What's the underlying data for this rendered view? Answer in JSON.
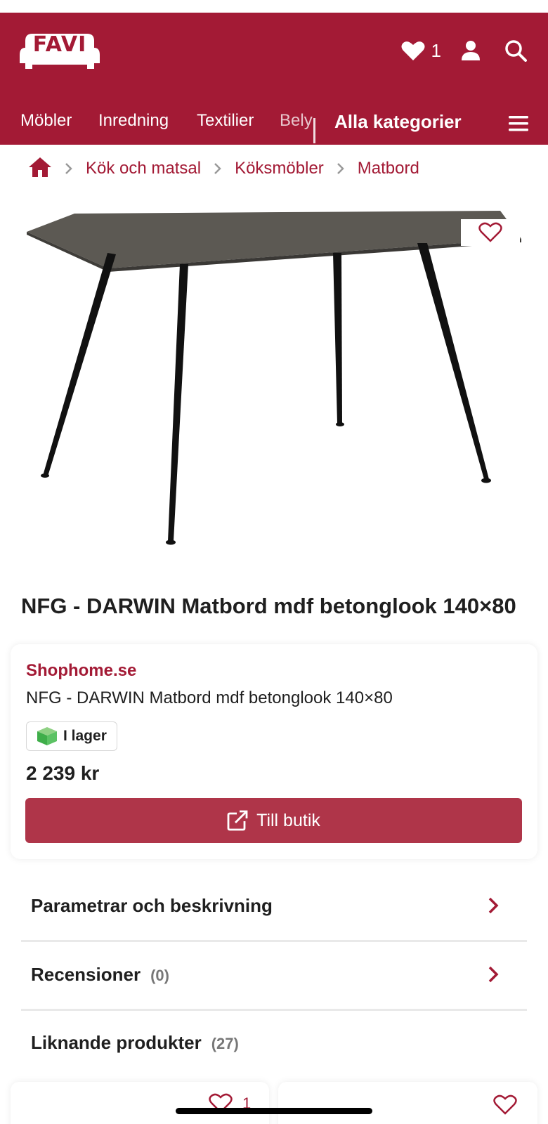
{
  "header": {
    "logo_text": "FAVI",
    "favorites_count": "1",
    "brand_color": "#a31a35",
    "icons": [
      "heart-icon",
      "user-icon",
      "search-icon",
      "menu-icon"
    ]
  },
  "nav": {
    "items": [
      "Möbler",
      "Inredning",
      "Textilier",
      "Bely"
    ],
    "all_categories": "Alla kategorier"
  },
  "breadcrumb": {
    "home_icon": "home-icon",
    "items": [
      "Kök och matsal",
      "Köksmöbler",
      "Matbord"
    ]
  },
  "product": {
    "title": "NFG - DARWIN Matbord mdf betonglook 140×80"
  },
  "offer": {
    "shop": "Shophome.se",
    "title": "NFG - DARWIN Matbord mdf betonglook 140×80",
    "stock": "I lager",
    "price": "2 239 kr",
    "button_label": "Till butik",
    "button_color": "#af3549"
  },
  "sections": [
    {
      "label": "Parametrar och beskrivning",
      "count": ""
    },
    {
      "label": "Recensioner",
      "count": "(0)"
    },
    {
      "label": "Liknande produkter",
      "count": "(27)"
    }
  ],
  "similar": {
    "favorite_count": "1"
  }
}
